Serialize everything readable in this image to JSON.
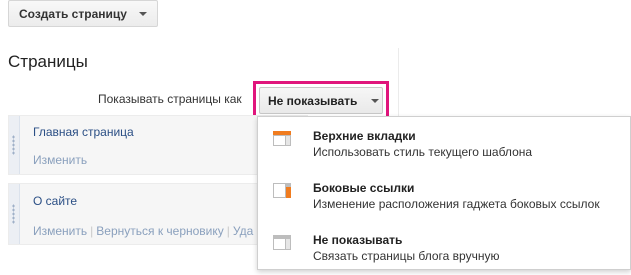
{
  "toolbar": {
    "create_page_label": "Создать страницу"
  },
  "pages": {
    "title": "Страницы",
    "show_pages_label": "Показывать страницы как",
    "show_pages_value": "Не показывать",
    "items": [
      {
        "title": "Главная страница",
        "actions": [
          "Изменить"
        ]
      },
      {
        "title": "О сайте",
        "actions": [
          "Изменить",
          "Вернуться к черновику",
          "Уда"
        ]
      }
    ]
  },
  "menu": {
    "options": [
      {
        "title": "Верхние вкладки",
        "description": "Использовать стиль текущего шаблона",
        "icon": "top-tabs-layout-icon"
      },
      {
        "title": "Боковые ссылки",
        "description": "Изменение расположения гаджета боковых ссылок",
        "icon": "side-links-layout-icon"
      },
      {
        "title": "Не показывать",
        "description": "Связать страницы блога вручную",
        "icon": "no-display-layout-icon"
      }
    ]
  },
  "colors": {
    "highlight": "#e0157c",
    "accent_orange": "#f07c1f",
    "link_blue": "#2b4f85"
  }
}
